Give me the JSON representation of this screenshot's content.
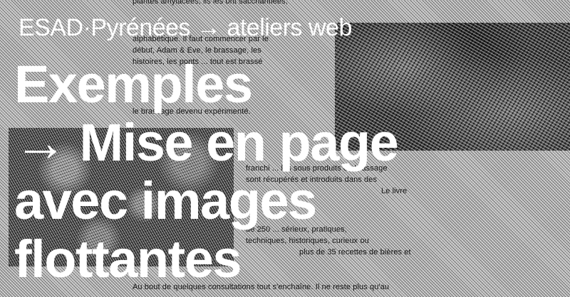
{
  "header": {
    "site_title": "ESAD·Pyrénées → ateliers web"
  },
  "hero": {
    "title_lines": [
      "Exemples",
      "→ Mise en page",
      "avec images",
      "flottantes"
    ]
  },
  "article": {
    "lines": [
      "plantes amylacées, ils les ont saccharifiées,",
      "alphabétique. Il faut commencer par le",
      "début, Adam & Eve, le brassage, les",
      "histoires, les ponts ... tout est brassé",
      "le brassage devenu expérimenté.",
      "franchi ... les sous produits du brassage",
      "sont récupérés et introduits dans des",
      "Le livre",
      "de 250 ... sérieux, pratiques,",
      "techniques, historiques, curieux ou",
      "plus de 35 recettes de bières et",
      "Au bout de quelques consultations tout s'enchaîne. Il ne reste plus qu'au"
    ]
  },
  "colors": {
    "background": "#c3c3c3",
    "text_overlay": "#ffffff",
    "body_text": "#141414",
    "image_dark": "#3e3e3e"
  }
}
